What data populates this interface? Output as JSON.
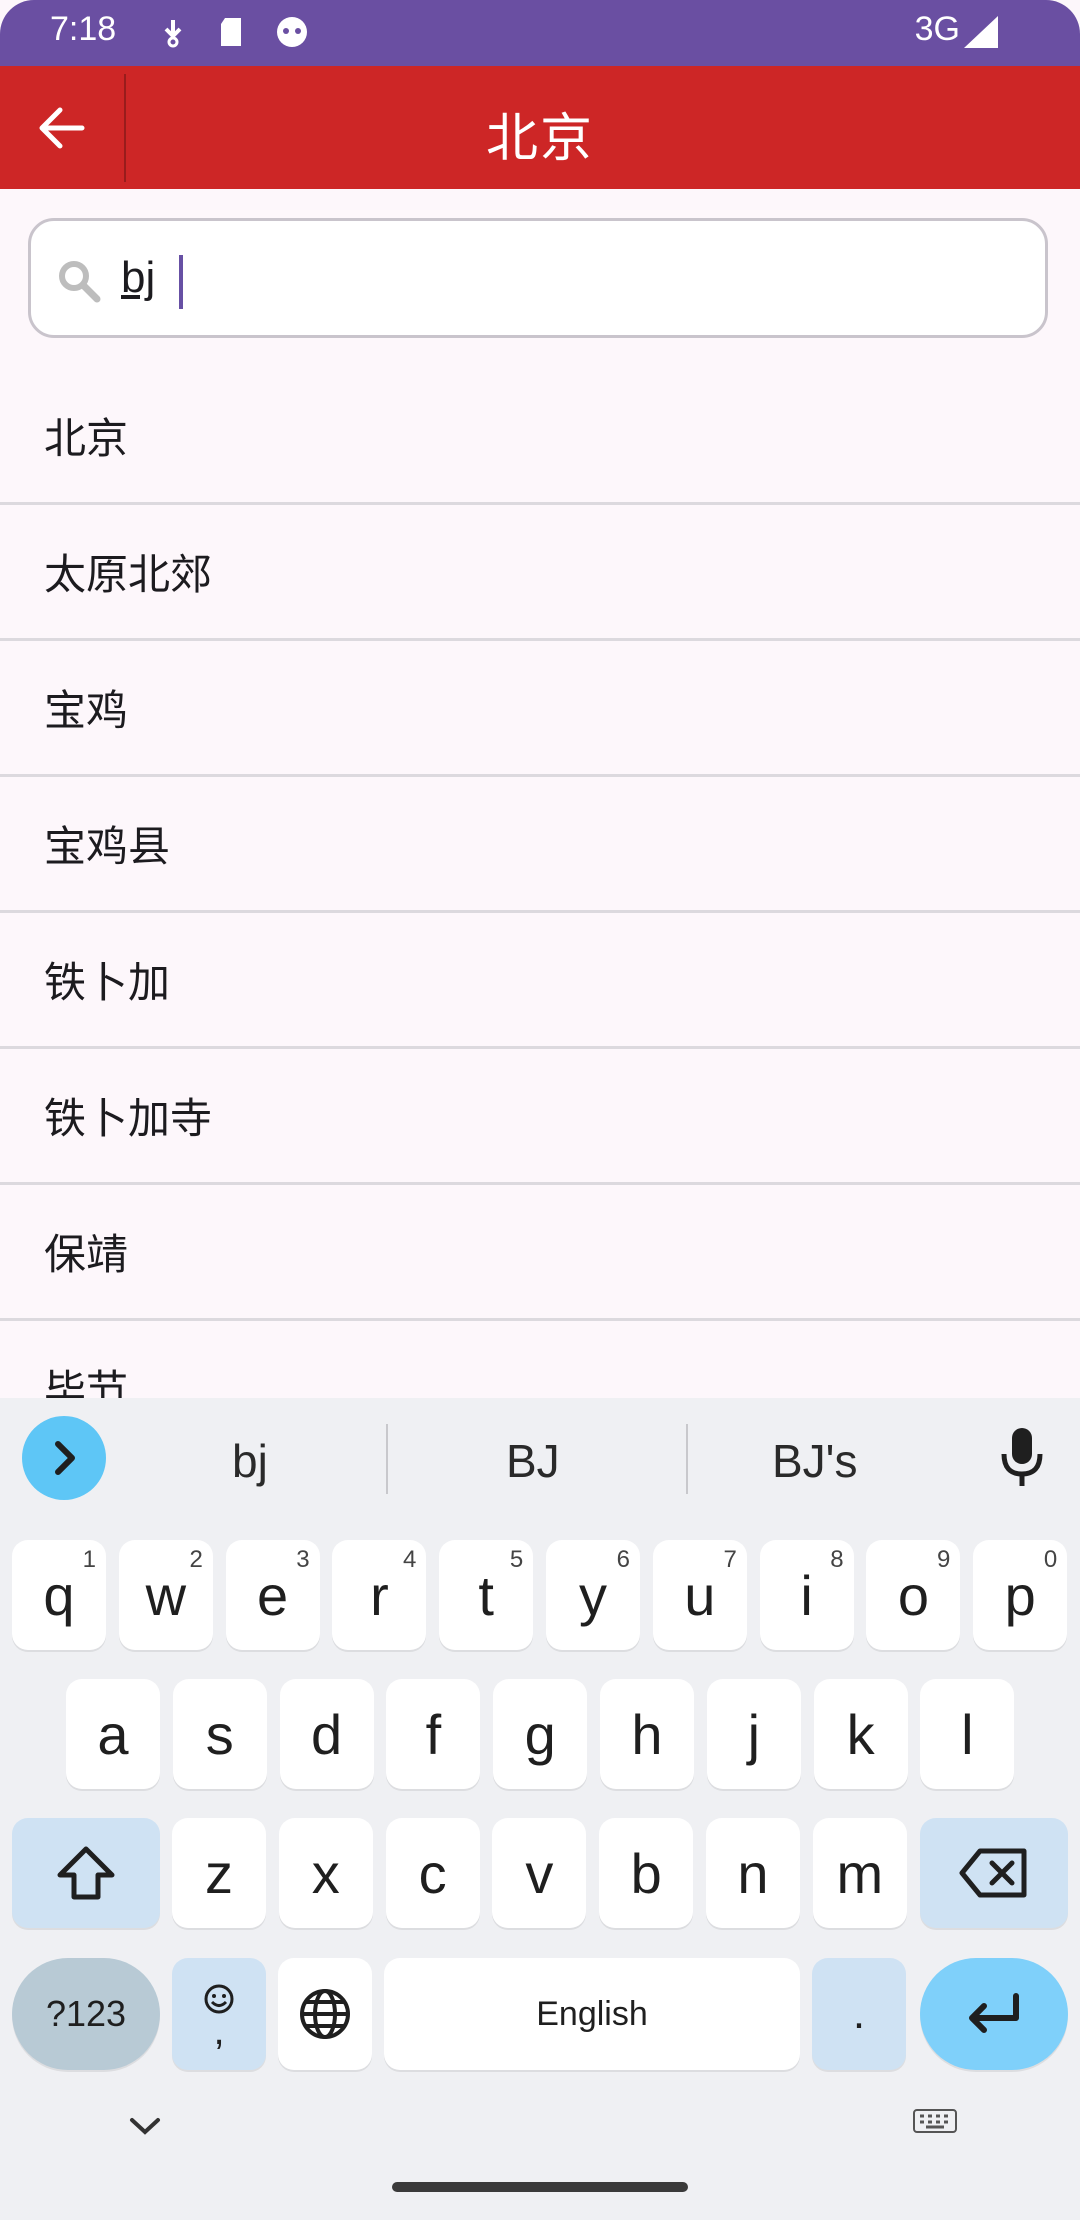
{
  "status_bar": {
    "time": "7:18",
    "network": "3G"
  },
  "app_bar": {
    "title": "北京"
  },
  "search": {
    "value": "bj",
    "placeholder": ""
  },
  "results": [
    "北京",
    "太原北郊",
    "宝鸡",
    "宝鸡县",
    "铁卜加",
    "铁卜加寺",
    "保靖",
    "毕节"
  ],
  "keyboard": {
    "suggestions": [
      "bj",
      "BJ",
      "BJ's"
    ],
    "row1": [
      {
        "k": "q",
        "n": "1"
      },
      {
        "k": "w",
        "n": "2"
      },
      {
        "k": "e",
        "n": "3"
      },
      {
        "k": "r",
        "n": "4"
      },
      {
        "k": "t",
        "n": "5"
      },
      {
        "k": "y",
        "n": "6"
      },
      {
        "k": "u",
        "n": "7"
      },
      {
        "k": "i",
        "n": "8"
      },
      {
        "k": "o",
        "n": "9"
      },
      {
        "k": "p",
        "n": "0"
      }
    ],
    "row2": [
      "a",
      "s",
      "d",
      "f",
      "g",
      "h",
      "j",
      "k",
      "l"
    ],
    "row3": [
      "z",
      "x",
      "c",
      "v",
      "b",
      "n",
      "m"
    ],
    "symbols_label": "?123",
    "comma_label": ",",
    "space_label": "English",
    "period_label": "."
  },
  "colors": {
    "status_bar": "#6a4fa2",
    "app_bar": "#cd2626",
    "accent": "#5ec6f6"
  }
}
